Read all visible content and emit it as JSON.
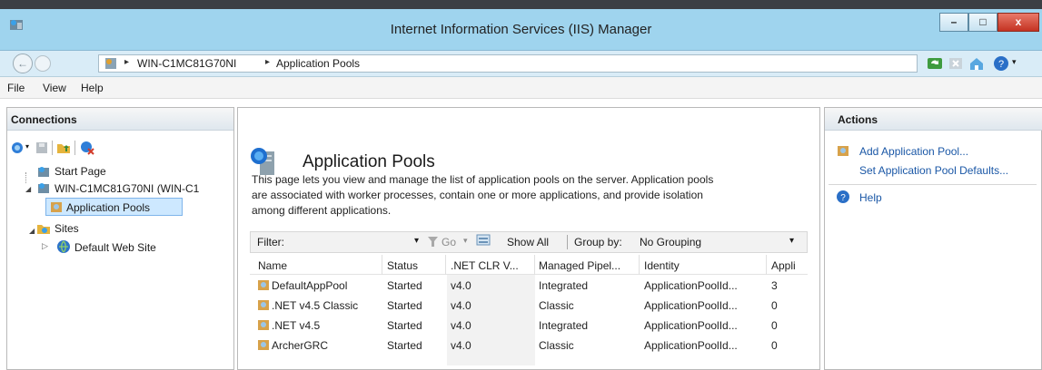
{
  "window": {
    "title": "Internet Information Services (IIS) Manager",
    "min_glyph": "–",
    "max_glyph": "□",
    "close_glyph": "x"
  },
  "address": {
    "crumbs": [
      "WIN-C1MC81G70NI",
      "Application Pools"
    ],
    "separator": "▸",
    "back_glyph": "←"
  },
  "menu": {
    "items": [
      "File",
      "View",
      "Help"
    ]
  },
  "connections": {
    "title": "Connections",
    "tree": [
      {
        "label": "Start Page",
        "icon": "start-page-icon"
      },
      {
        "label": "WIN-C1MC81G70NI (WIN-C1",
        "icon": "server-icon",
        "expander": "◢"
      },
      {
        "label": "Application Pools",
        "icon": "app-pools-icon",
        "selected": true
      },
      {
        "label": "Sites",
        "icon": "folder-icon",
        "expander": "◢"
      },
      {
        "label": "Default Web Site",
        "icon": "globe-icon",
        "expander": "▷"
      }
    ]
  },
  "center": {
    "title": "Application Pools",
    "description": [
      "This page lets you view and manage the list of application pools on the server. Application pools",
      "are associated with worker processes, contain one or more applications, and provide isolation",
      "among different applications."
    ],
    "filter": {
      "label": "Filter:",
      "go": "Go",
      "show_all": "Show All",
      "group_by_label": "Group by:",
      "group_by_value": "No Grouping",
      "dropdown_glyph": "▾"
    },
    "columns": [
      "Name",
      "Status",
      ".NET CLR V...",
      "Managed Pipel...",
      "Identity",
      "Appli"
    ],
    "rows": [
      [
        "DefaultAppPool",
        "Started",
        "v4.0",
        "Integrated",
        "ApplicationPoolId...",
        "3"
      ],
      [
        ".NET v4.5 Classic",
        "Started",
        "v4.0",
        "Classic",
        "ApplicationPoolId...",
        "0"
      ],
      [
        ".NET v4.5",
        "Started",
        "v4.0",
        "Integrated",
        "ApplicationPoolId...",
        "0"
      ],
      [
        "ArcherGRC",
        "Started",
        "v4.0",
        "Classic",
        "ApplicationPoolId...",
        "0"
      ]
    ]
  },
  "actions": {
    "title": "Actions",
    "items": [
      "Add Application Pool...",
      "Set Application Pool Defaults...",
      "Help"
    ]
  },
  "colors": {
    "titlebar": "#9fd4ee",
    "link": "#1a57a6",
    "selected_bg": "#cde8ff",
    "selected_border": "#7eb4ea"
  }
}
